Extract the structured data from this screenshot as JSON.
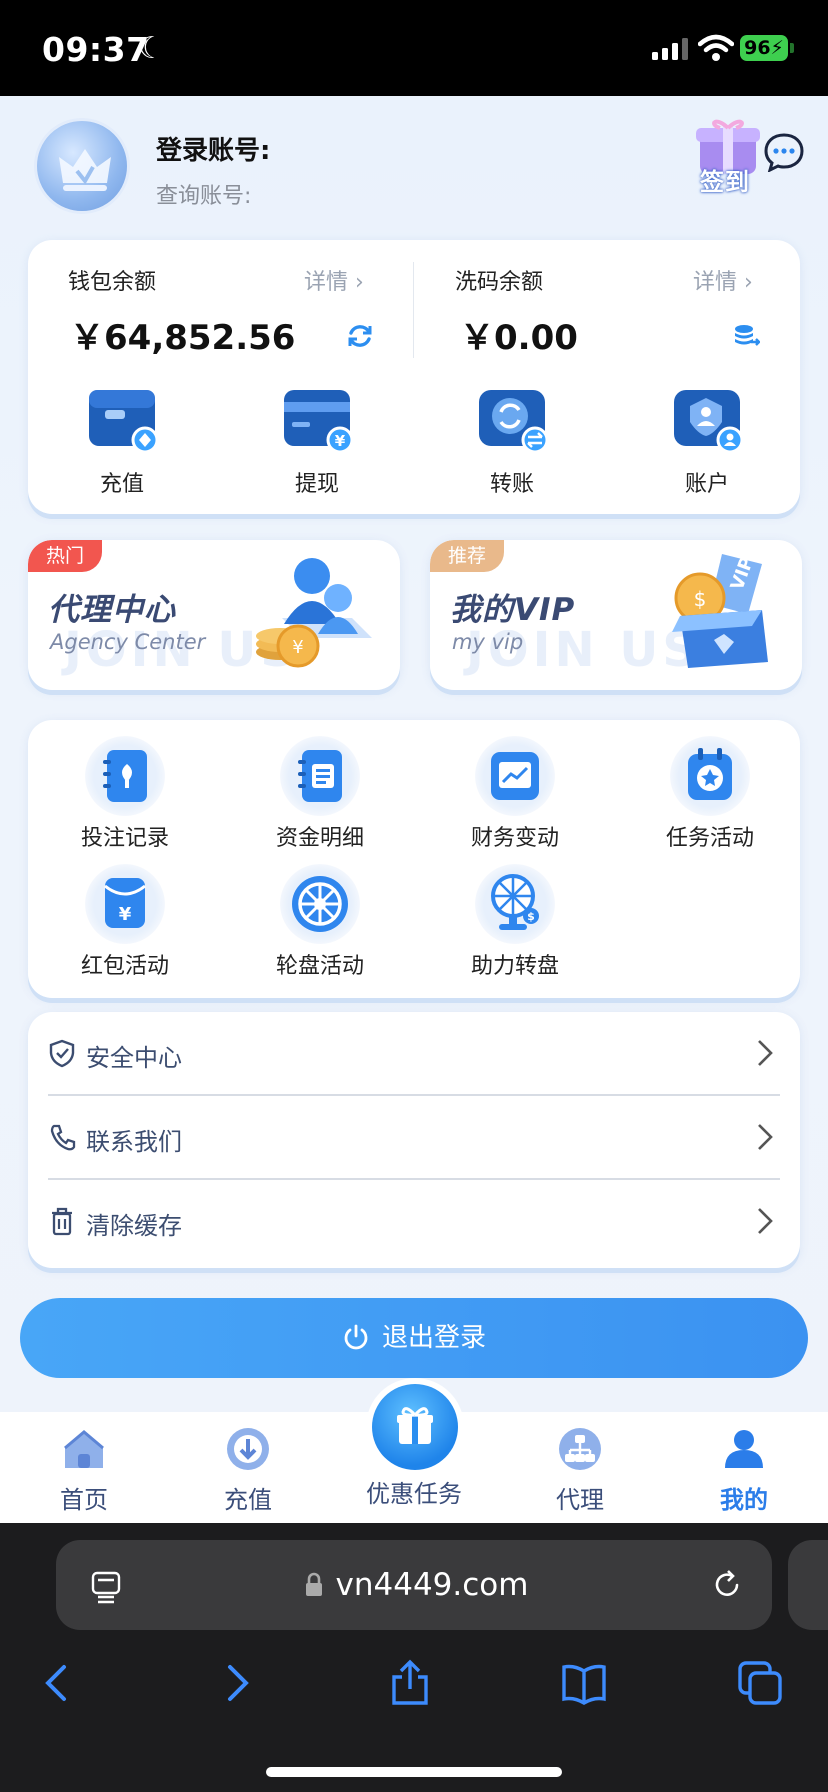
{
  "status_bar": {
    "time": "09:37",
    "battery": "96"
  },
  "profile": {
    "login_label": "登录账号:",
    "query_label": "查询账号:",
    "signin_label": "签到"
  },
  "wallet": {
    "title": "钱包余额",
    "detail": "详情 ›",
    "amount": "￥64,852.56"
  },
  "wash": {
    "title": "洗码余额",
    "detail": "详情 ›",
    "amount": "￥0.00"
  },
  "quick_actions": [
    {
      "label": "充值",
      "icon": "wallet-deposit-icon"
    },
    {
      "label": "提现",
      "icon": "card-withdraw-icon"
    },
    {
      "label": "转账",
      "icon": "transfer-icon"
    },
    {
      "label": "账户",
      "icon": "account-icon"
    }
  ],
  "banners": [
    {
      "tag": "热门",
      "title": "代理中心",
      "subtitle": "Agency Center",
      "ghost": "JOIN US",
      "tag_color": "#f2564f"
    },
    {
      "tag": "推荐",
      "title": "我的VIP",
      "subtitle": "my vip",
      "ghost": "JOIN US",
      "tag_color": "#e9b98b"
    }
  ],
  "grid_items": [
    {
      "label": "投注记录",
      "icon": "betting-record-icon"
    },
    {
      "label": "资金明细",
      "icon": "fund-details-icon"
    },
    {
      "label": "财务变动",
      "icon": "finance-chart-icon"
    },
    {
      "label": "任务活动",
      "icon": "task-activity-icon"
    },
    {
      "label": "红包活动",
      "icon": "red-envelope-icon"
    },
    {
      "label": "轮盘活动",
      "icon": "roulette-icon"
    },
    {
      "label": "助力转盘",
      "icon": "assist-wheel-icon"
    }
  ],
  "menu": [
    {
      "label": "安全中心",
      "icon": "shield-icon"
    },
    {
      "label": "联系我们",
      "icon": "phone-icon"
    },
    {
      "label": "清除缓存",
      "icon": "trash-icon"
    }
  ],
  "logout_label": "退出登录",
  "tabbar": [
    {
      "label": "首页",
      "icon": "home-icon"
    },
    {
      "label": "充值",
      "icon": "deposit-icon"
    },
    {
      "label": "优惠任务",
      "icon": "gift-icon"
    },
    {
      "label": "代理",
      "icon": "agent-icon"
    },
    {
      "label": "我的",
      "icon": "user-icon",
      "active": true
    }
  ],
  "browser": {
    "url": "vn4449.com"
  },
  "colors": {
    "accent": "#3b92f1",
    "tab_active": "#2b7de9",
    "hot_tag": "#f2564f",
    "recommend_tag": "#e9b98b"
  }
}
